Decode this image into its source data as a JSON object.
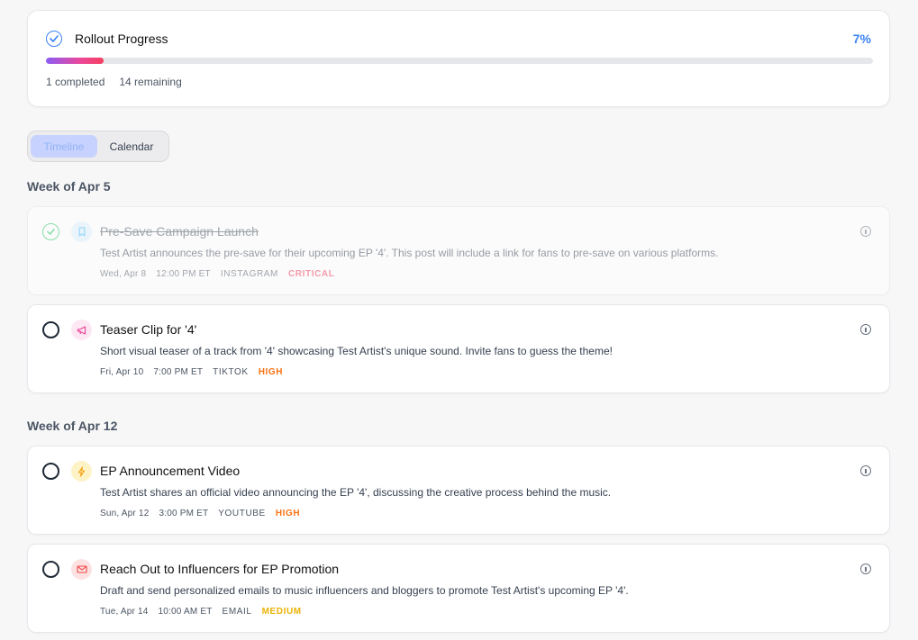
{
  "progress": {
    "title": "Rollout Progress",
    "percent_label": "7%",
    "percent": 7,
    "completed_label": "1 completed",
    "remaining_label": "14 remaining"
  },
  "view_toggle": {
    "timeline": "Timeline",
    "calendar": "Calendar",
    "active": "timeline"
  },
  "weeks": [
    {
      "label": "Week of Apr 5",
      "tasks": [
        {
          "title": "Pre-Save Campaign Launch",
          "description": "Test Artist announces the pre-save for their upcoming EP '4'. This post will include a link for fans to pre-save on various platforms.",
          "date": "Wed, Apr 8",
          "time": "12:00 PM ET",
          "platform": "INSTAGRAM",
          "priority": "CRITICAL",
          "completed": true,
          "icon": "bookmark-icon"
        },
        {
          "title": "Teaser Clip for '4'",
          "description": "Short visual teaser of a track from '4' showcasing Test Artist's unique sound. Invite fans to guess the theme!",
          "date": "Fri, Apr 10",
          "time": "7:00 PM ET",
          "platform": "TIKTOK",
          "priority": "HIGH",
          "completed": false,
          "icon": "megaphone-icon"
        }
      ]
    },
    {
      "label": "Week of Apr 12",
      "tasks": [
        {
          "title": "EP Announcement Video",
          "description": "Test Artist shares an official video announcing the EP '4', discussing the creative process behind the music.",
          "date": "Sun, Apr 12",
          "time": "3:00 PM ET",
          "platform": "YOUTUBE",
          "priority": "HIGH",
          "completed": false,
          "icon": "lightning-icon"
        },
        {
          "title": "Reach Out to Influencers for EP Promotion",
          "description": "Draft and send personalized emails to music influencers and bloggers to promote Test Artist's upcoming EP '4'.",
          "date": "Tue, Apr 14",
          "time": "10:00 AM ET",
          "platform": "EMAIL",
          "priority": "MEDIUM",
          "completed": false,
          "icon": "envelope-icon"
        }
      ]
    }
  ],
  "colors": {
    "accent": "#3b82f6",
    "critical": "#f43f5e",
    "high": "#f97316",
    "medium": "#eab308",
    "done": "#22c55e"
  }
}
